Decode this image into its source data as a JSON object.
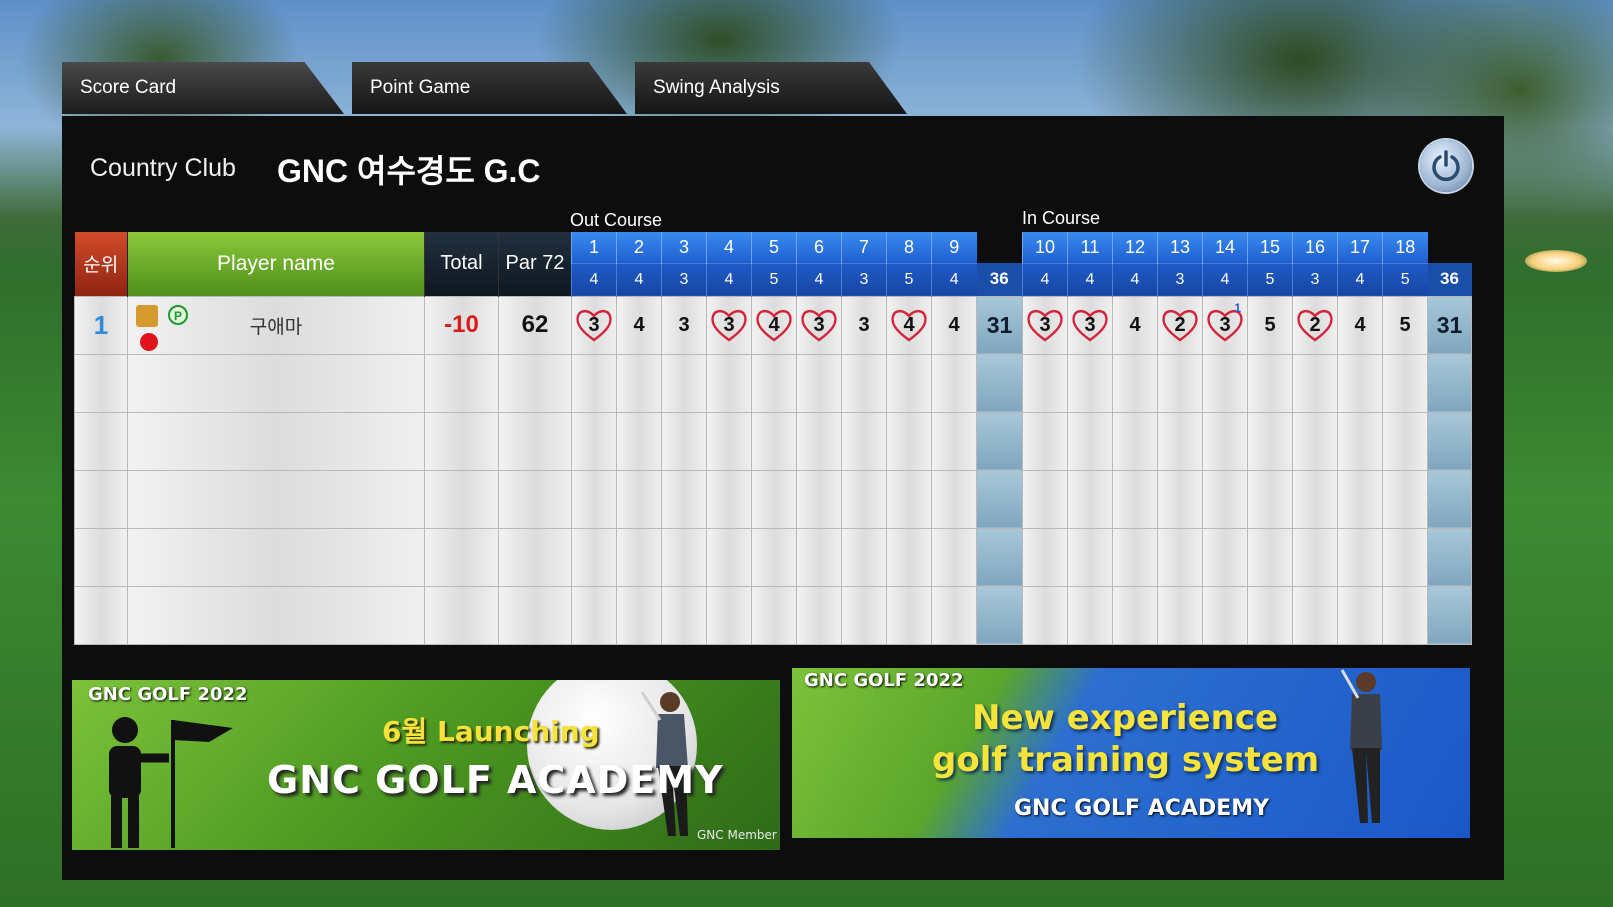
{
  "tabs": [
    {
      "label": "Score Card",
      "active": true
    },
    {
      "label": "Point Game",
      "active": false
    },
    {
      "label": "Swing Analysis",
      "active": false
    }
  ],
  "club": {
    "label": "Country Club",
    "name": "GNC 여수경도 G.C"
  },
  "course": {
    "out_label": "Out Course",
    "in_label": "In Course"
  },
  "header": {
    "rank": "순위",
    "player": "Player name",
    "total": "Total",
    "par": "Par 72"
  },
  "holes_out": [
    "1",
    "2",
    "3",
    "4",
    "5",
    "6",
    "7",
    "8",
    "9"
  ],
  "par_out": [
    "4",
    "4",
    "3",
    "4",
    "5",
    "4",
    "3",
    "5",
    "4"
  ],
  "par_out_total": "36",
  "holes_in": [
    "10",
    "11",
    "12",
    "13",
    "14",
    "15",
    "16",
    "17",
    "18"
  ],
  "par_in": [
    "4",
    "4",
    "4",
    "3",
    "4",
    "5",
    "3",
    "4",
    "5"
  ],
  "par_in_total": "36",
  "player": {
    "rank": "1",
    "name": "구애마",
    "badge": "P",
    "total": "-10",
    "gross": "62",
    "scores_out": [
      "3",
      "4",
      "3",
      "3",
      "4",
      "3",
      "3",
      "4",
      "4"
    ],
    "hearts_out": [
      true,
      false,
      false,
      true,
      true,
      true,
      false,
      true,
      false
    ],
    "out_total": "31",
    "scores_in": [
      "3",
      "3",
      "4",
      "2",
      "3",
      "5",
      "2",
      "4",
      "5"
    ],
    "hearts_in": [
      true,
      true,
      false,
      true,
      true,
      false,
      true,
      false,
      false
    ],
    "in_marks": [
      "",
      "",
      "",
      "",
      "1",
      "",
      "",
      "",
      ""
    ],
    "in_total": "31"
  },
  "ads": {
    "left": {
      "year": "GNC GOLF 2022",
      "launch": "6월 Launching",
      "academy": "GNC GOLF ACADEMY",
      "member": "GNC Member"
    },
    "right": {
      "year": "GNC GOLF 2022",
      "line1": "New experience",
      "line2": "golf training system",
      "brand": "GNC GOLF ACADEMY"
    }
  },
  "colors": {
    "heart": "#d3243a",
    "rank": "#2f8bd8",
    "total": "#d81c1c",
    "hole_header": "#2a74e0"
  },
  "icons": {
    "power": "power-icon",
    "heart": "heart-icon",
    "badge": "p-badge-icon"
  }
}
